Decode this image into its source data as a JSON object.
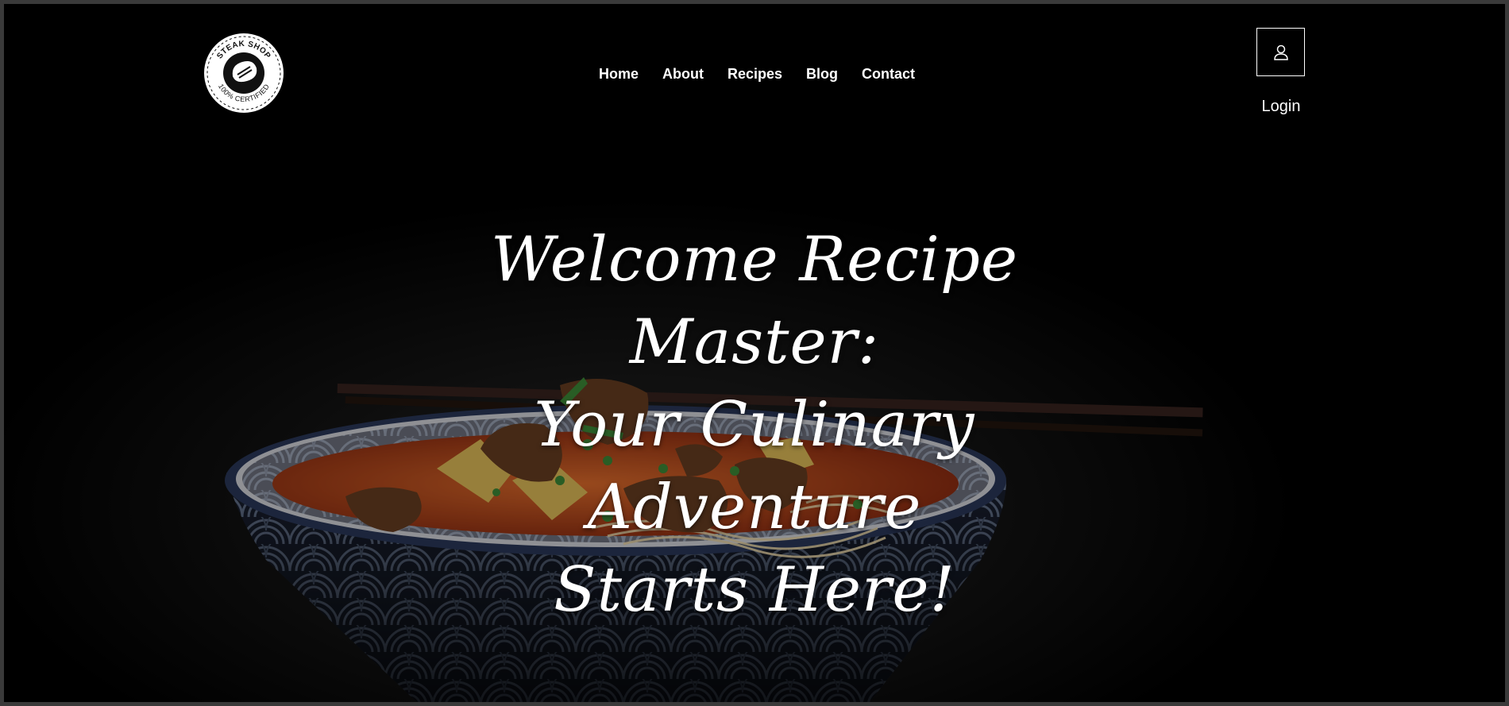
{
  "logo": {
    "top_text": "STEAK SHOP",
    "bottom_text": "100% CERTIFIED"
  },
  "nav": {
    "items": [
      "Home",
      "About",
      "Recipes",
      "Blog",
      "Contact"
    ]
  },
  "login": {
    "label": "Login",
    "icon": "user-icon"
  },
  "hero": {
    "line1": "Welcome Recipe Master:",
    "line2": "Your Culinary Adventure",
    "line3": "Starts Here!",
    "background": "noodle-soup-bowl-photo"
  },
  "colors": {
    "background": "#000000",
    "text": "#ffffff",
    "bowl_blue": "#3b4f7a",
    "broth": "#c9471f"
  }
}
